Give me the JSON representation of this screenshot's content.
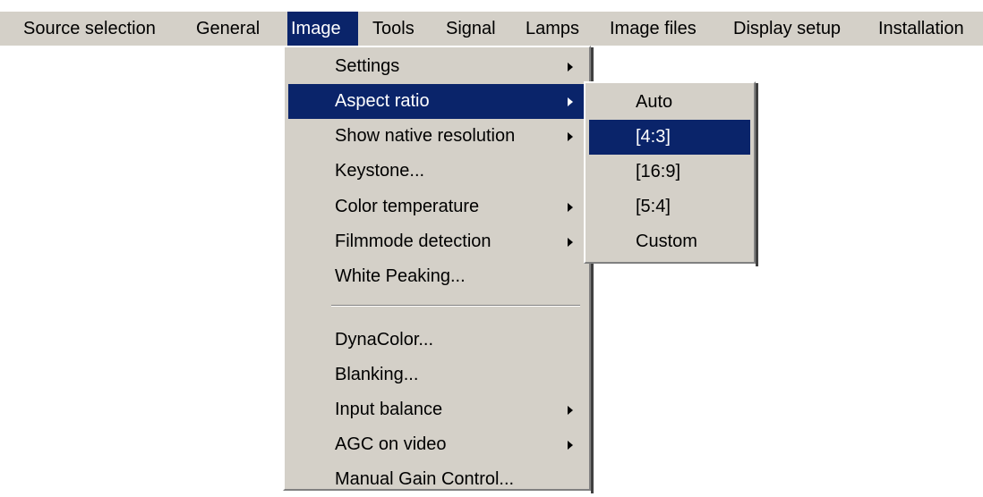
{
  "menubar": {
    "items": [
      {
        "label": "Source selection"
      },
      {
        "label": "General"
      },
      {
        "label": "Image"
      },
      {
        "label": "Tools"
      },
      {
        "label": "Signal"
      },
      {
        "label": "Lamps"
      },
      {
        "label": "Image files"
      },
      {
        "label": "Display setup"
      },
      {
        "label": "Installation"
      }
    ],
    "active": "Image"
  },
  "image_menu": {
    "items": [
      {
        "label": "Settings",
        "submenu": true
      },
      {
        "label": "Aspect ratio",
        "submenu": true
      },
      {
        "label": "Show native resolution",
        "submenu": true
      },
      {
        "label": "Keystone...",
        "submenu": false
      },
      {
        "label": "Color temperature",
        "submenu": true
      },
      {
        "label": "Filmmode detection",
        "submenu": true
      },
      {
        "label": "White Peaking...",
        "submenu": false
      },
      {
        "label": "DynaColor...",
        "submenu": false
      },
      {
        "label": "Blanking...",
        "submenu": false
      },
      {
        "label": "Input balance",
        "submenu": true
      },
      {
        "label": "AGC on video",
        "submenu": true
      },
      {
        "label": "Manual Gain Control...",
        "submenu": false
      }
    ],
    "highlighted": "Aspect ratio"
  },
  "aspect_menu": {
    "items": [
      {
        "label": "Auto"
      },
      {
        "label": "[4:3]"
      },
      {
        "label": "[16:9]"
      },
      {
        "label": "[5:4]"
      },
      {
        "label": "Custom"
      }
    ],
    "highlighted": "[4:3]"
  },
  "colors": {
    "menu_background": "#d4d0c8",
    "highlight": "#0a246a",
    "highlight_text": "#ffffff"
  }
}
